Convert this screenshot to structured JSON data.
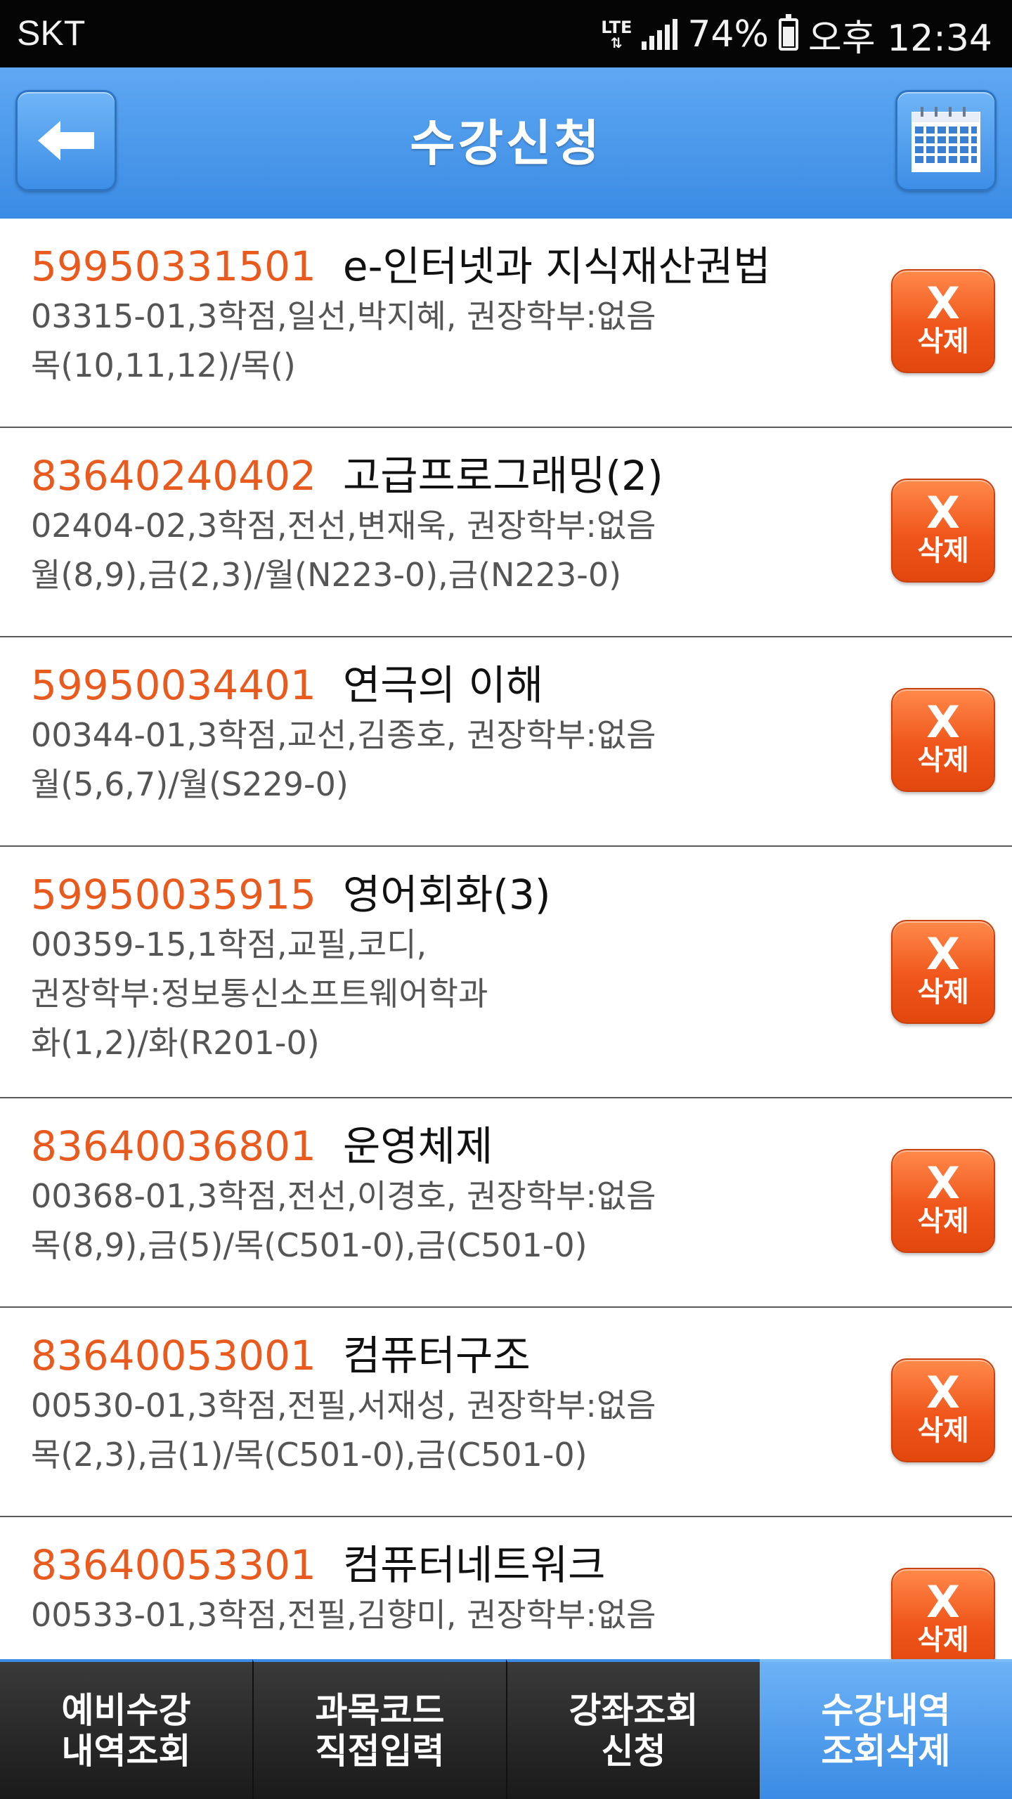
{
  "status_bar": {
    "carrier": "SKT",
    "network": "LTE",
    "battery": "74%",
    "time": "오후 12:34"
  },
  "header": {
    "title": "수강신청",
    "back_icon": "arrow-left-icon",
    "calendar_icon": "calendar-icon"
  },
  "courses": [
    {
      "code": "59950331501",
      "name": "e-인터넷과 지식재산권법",
      "details": [
        "03315-01,3학점,일선,박지혜, 권장학부:없음",
        "목(10,11,12)/목()"
      ],
      "delete_label": "삭제"
    },
    {
      "code": "83640240402",
      "name": "고급프로그래밍(2)",
      "details": [
        "02404-02,3학점,전선,변재욱, 권장학부:없음",
        "월(8,9),금(2,3)/월(N223-0),금(N223-0)"
      ],
      "delete_label": "삭제"
    },
    {
      "code": "59950034401",
      "name": "연극의 이해",
      "details": [
        "00344-01,3학점,교선,김종호, 권장학부:없음",
        "월(5,6,7)/월(S229-0)"
      ],
      "delete_label": "삭제"
    },
    {
      "code": "59950035915",
      "name": "영어회화(3)",
      "details": [
        "00359-15,1학점,교필,코디,",
        "권장학부:정보통신소프트웨어학과",
        "화(1,2)/화(R201-0)"
      ],
      "delete_label": "삭제"
    },
    {
      "code": "83640036801",
      "name": "운영체제",
      "details": [
        "00368-01,3학점,전선,이경호, 권장학부:없음",
        "목(8,9),금(5)/목(C501-0),금(C501-0)"
      ],
      "delete_label": "삭제"
    },
    {
      "code": "83640053001",
      "name": "컴퓨터구조",
      "details": [
        "00530-01,3학점,전필,서재성, 권장학부:없음",
        "목(2,3),금(1)/목(C501-0),금(C501-0)"
      ],
      "delete_label": "삭제"
    },
    {
      "code": "83640053301",
      "name": "컴퓨터네트워크",
      "details": [
        "00533-01,3학점,전필,김향미, 권장학부:없음"
      ],
      "delete_label": "삭제"
    }
  ],
  "bottom_nav": [
    {
      "label": "예비수강\n내역조회",
      "active": false
    },
    {
      "label": "과목코드\n직접입력",
      "active": false
    },
    {
      "label": "강좌조회\n신청",
      "active": false
    },
    {
      "label": "수강내역\n조회삭제",
      "active": true
    }
  ],
  "colors": {
    "header_blue": "#3a8be4",
    "course_code_orange": "#e85a1e",
    "delete_button_orange": "#f0561b"
  }
}
